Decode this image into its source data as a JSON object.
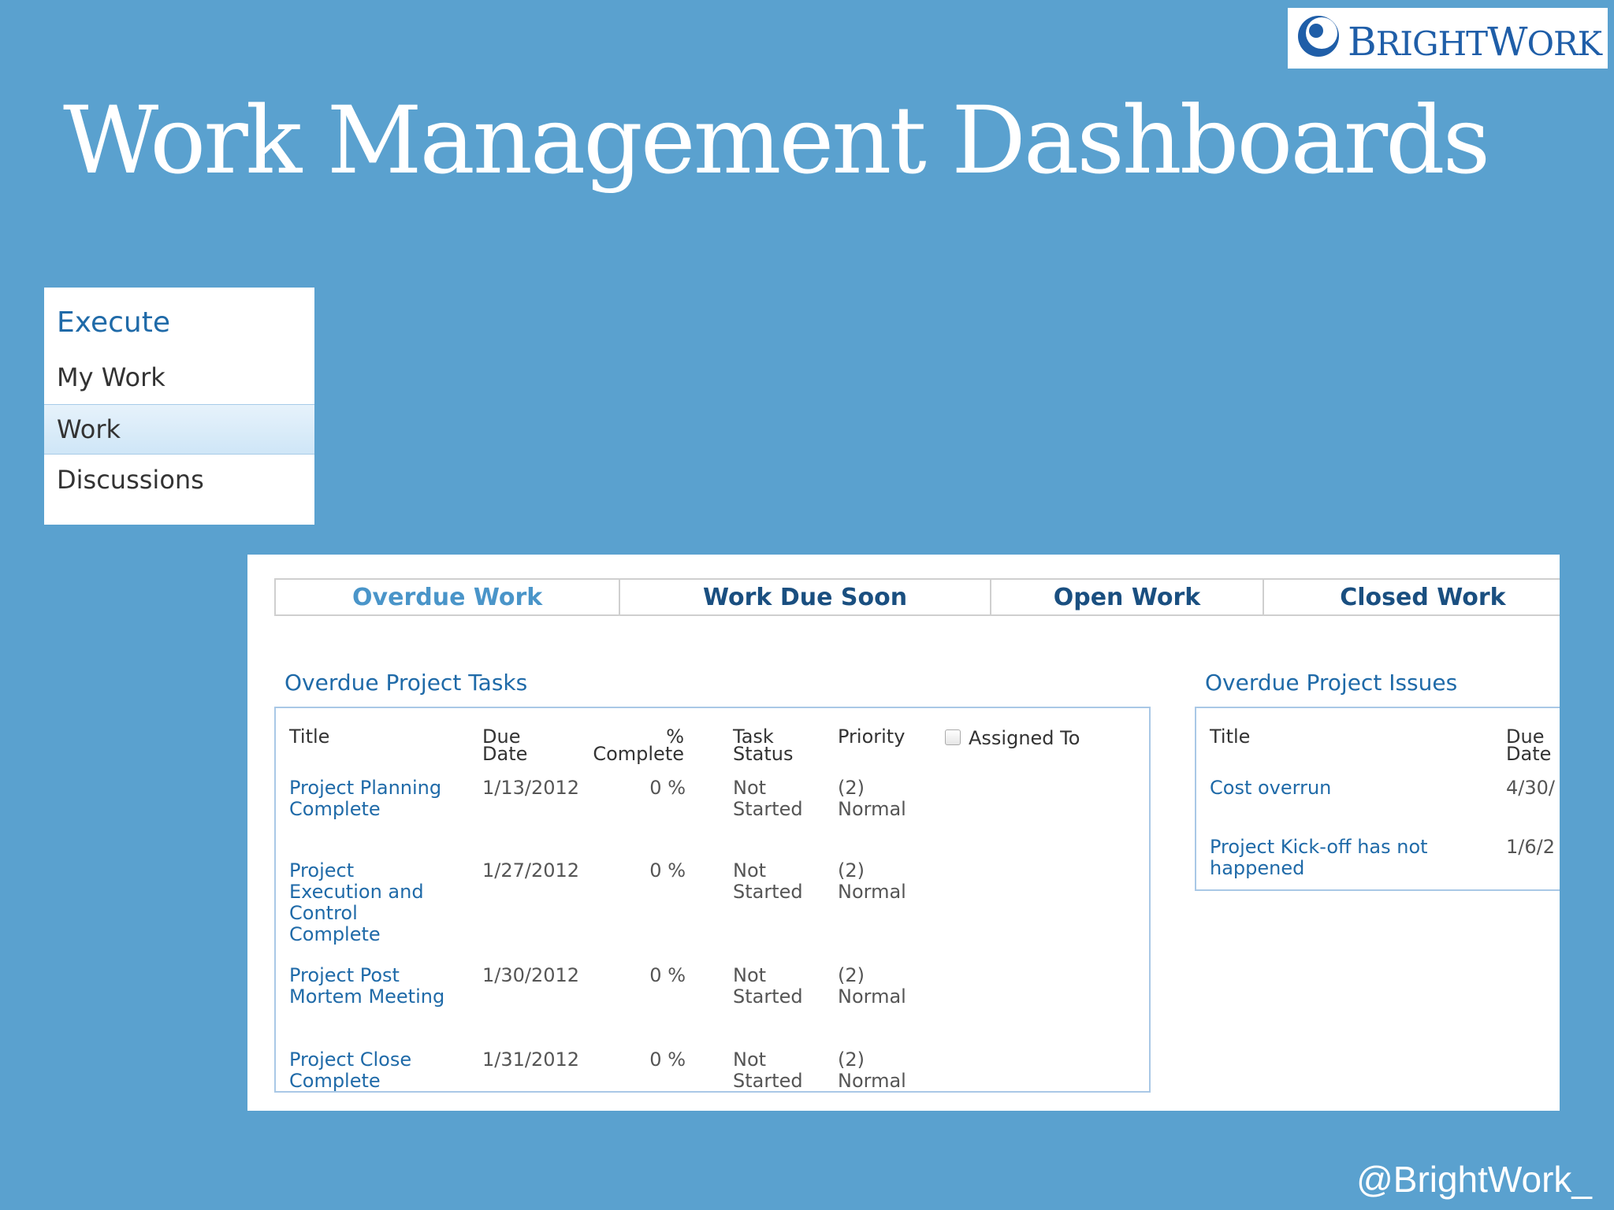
{
  "logo": {
    "text_first": "B",
    "text_mid": "RIGHT",
    "text_second": "W",
    "text_end": "ORK"
  },
  "slide_title": "Work Management Dashboards",
  "nav": {
    "heading": "Execute",
    "items": [
      "My Work",
      "Work",
      "Discussions"
    ],
    "selected": "Work"
  },
  "tabs": [
    "Overdue Work",
    "Work Due Soon",
    "Open Work",
    "Closed Work"
  ],
  "active_tab": "Overdue Work",
  "tasks": {
    "title": "Overdue Project Tasks",
    "headers": {
      "title": "Title",
      "due_date_1": "Due",
      "due_date_2": "Date",
      "pct_1": "%",
      "pct_2": "Complete",
      "status_1": "Task",
      "status_2": "Status",
      "priority": "Priority",
      "assigned": "Assigned To"
    },
    "rows": [
      {
        "title": "Project Planning Complete",
        "due": "1/13/2012",
        "pct": "0 %",
        "status": "Not Started",
        "priority": "(2) Normal"
      },
      {
        "title": "Project Execution and Control Complete",
        "due": "1/27/2012",
        "pct": "0 %",
        "status": "Not Started",
        "priority": "(2) Normal"
      },
      {
        "title": "Project Post Mortem Meeting",
        "due": "1/30/2012",
        "pct": "0 %",
        "status": "Not Started",
        "priority": "(2) Normal"
      },
      {
        "title": "Project Close Complete",
        "due": "1/31/2012",
        "pct": "0 %",
        "status": "Not Started",
        "priority": "(2) Normal"
      }
    ]
  },
  "issues": {
    "title": "Overdue Project Issues",
    "headers": {
      "title": "Title",
      "due_1": "Due",
      "due_2": "Date"
    },
    "rows": [
      {
        "title": "Cost overrun",
        "due": "4/30/"
      },
      {
        "title": "Project Kick-off has not happened",
        "due": "1/6/2"
      }
    ]
  },
  "handle": "@BrightWork_",
  "colors": {
    "background": "#5aa1cf",
    "link": "#1f6aa8",
    "active_tab": "#4a95c9",
    "tab_text": "#1a4f80"
  }
}
